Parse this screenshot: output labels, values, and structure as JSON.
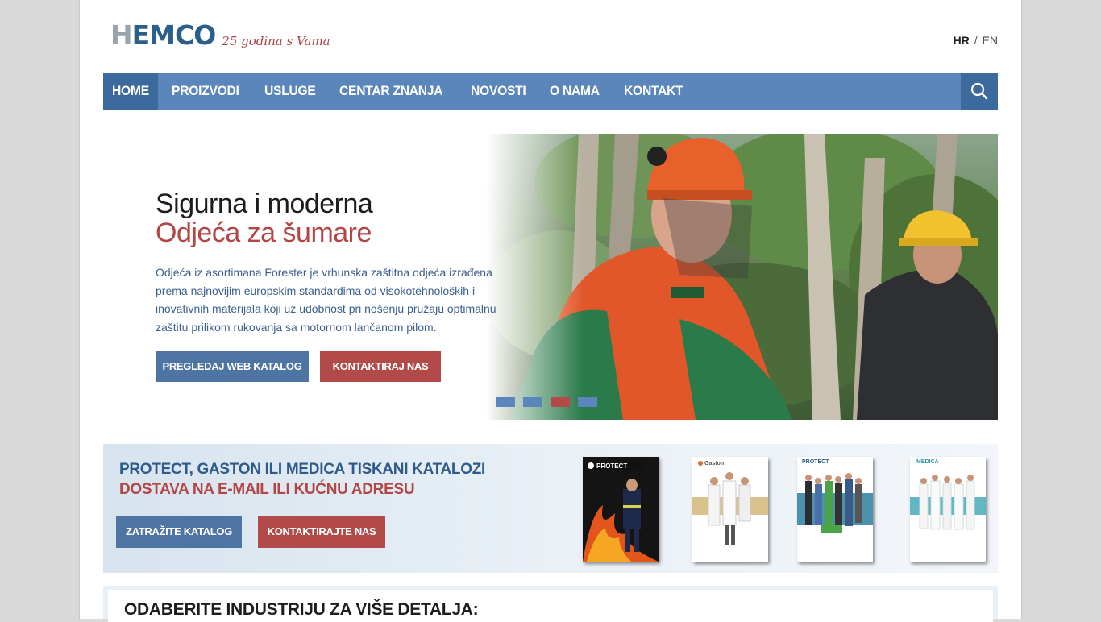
{
  "header": {
    "logo_h": "H",
    "logo_rest": "EMCO",
    "tagline": "25 godina s Vama",
    "lang_hr": "HR",
    "lang_sep": "/",
    "lang_en": "EN"
  },
  "nav": {
    "items": [
      "HOME",
      "PROIZVODI",
      "USLUGE",
      "CENTAR ZNANJA",
      "NOVOSTI",
      "O NAMA",
      "KONTAKT"
    ],
    "active_index": 0,
    "search_icon": "search-icon"
  },
  "hero": {
    "title_line1": "Sigurna i moderna",
    "title_line2": "Odjeća za šumare",
    "text": "Odjeća iz asortimana Forester je vrhunska zaštitna odjeća izrađena prema najnovijim europskim standardima od visokotehnoloških i inovativnih materijala koji uz udobnost pri nošenju pružaju optimalnu zaštitu prilikom rukovanja sa motornom lančanom pilom.",
    "btn_catalog": "PREGLEDAJ WEB KATALOG",
    "btn_contact": "KONTAKTIRAJ NAS",
    "slides_count": 4,
    "active_slide": 2
  },
  "catalog": {
    "line1": "PROTECT, GASTON ILI MEDICA TISKANI KATALOZI",
    "line2": "DOSTAVA NA E-MAIL ILI KUĆNU ADRESU",
    "btn_request": "ZATRAŽITE KATALOG",
    "btn_contact": "KONTAKTIRAJTE NAS",
    "covers": [
      {
        "brand": "PROTECT",
        "name": "cover-protect-fire"
      },
      {
        "brand": "Gaston",
        "name": "cover-gaston"
      },
      {
        "brand": "PROTECT",
        "name": "cover-protect-workwear"
      },
      {
        "brand": "MEDICA",
        "name": "cover-medica"
      }
    ]
  },
  "industry": {
    "title": "ODABERITE INDUSTRIJU ZA VIŠE DETALJA:"
  },
  "colors": {
    "nav_blue": "#5a86bb",
    "nav_active": "#3d6a9c",
    "accent_red": "#b34545",
    "text_blue": "#3b5f8e"
  }
}
